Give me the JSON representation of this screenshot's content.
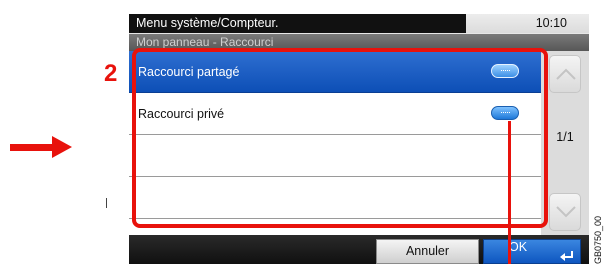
{
  "header": {
    "title": "Menu système/Compteur.",
    "time": "10:10",
    "subtitle": "Mon panneau - Raccourci"
  },
  "list": {
    "items": [
      {
        "label": "Raccourci partagé",
        "selected": true
      },
      {
        "label": "Raccourci privé",
        "selected": false
      },
      {
        "label": "",
        "selected": false
      },
      {
        "label": "",
        "selected": false
      }
    ]
  },
  "pagination": {
    "page": "1/1"
  },
  "footer": {
    "cancel_label": "Annuler",
    "ok_label": "OK"
  },
  "annotation": {
    "step_number": "2",
    "figure_id": "GB0750_00"
  },
  "colors": {
    "highlight": "#e8120c",
    "selected_row": "#1a5ec4",
    "ok_button": "#1a64cc"
  }
}
